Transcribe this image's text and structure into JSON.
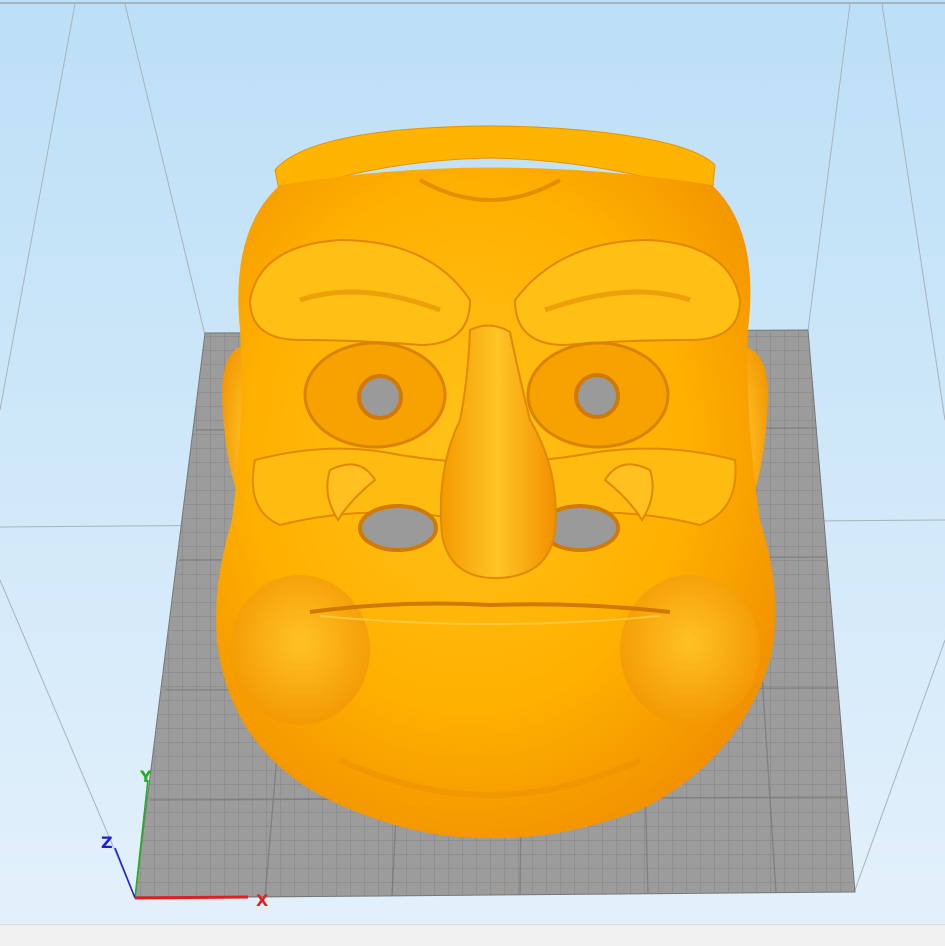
{
  "viewport": {
    "colors": {
      "sky_top": "#b8dcf6",
      "sky_bottom": "#e2f0fb",
      "build_plate": "#9a9a9a",
      "grid_line": "#7e7e7e",
      "model": "#ffb300",
      "model_shadow": "#e98a00",
      "model_highlight": "#ffd24a",
      "axis_x": "#e02020",
      "axis_y": "#20c020",
      "axis_z": "#2020d0"
    },
    "axis_gizmo": {
      "x_label": "X",
      "y_label": "Y",
      "z_label": "Z"
    },
    "model_name_icon": "mask-model-icon"
  }
}
